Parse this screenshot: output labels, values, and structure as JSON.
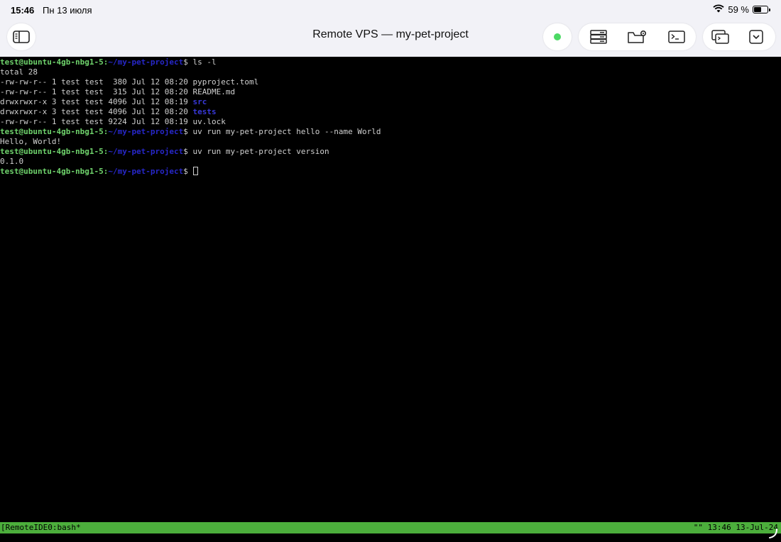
{
  "status": {
    "time": "15:46",
    "date": "Пн 13 июля",
    "battery": "59 %",
    "battery_level": 0.59
  },
  "toolbar": {
    "title": "Remote VPS — my-pet-project",
    "icons": [
      "sidebar-icon",
      "connection-status-dot",
      "server-icon",
      "folder-settings-icon",
      "terminal-icon",
      "windows-icon",
      "chevron-down-icon"
    ]
  },
  "terminal": {
    "prompt_user": "test@ubuntu-4gb-nbg1-5",
    "prompt_path": "~/my-pet-project",
    "cmd1": "ls -l",
    "total": "total 28",
    "files": [
      {
        "meta": "-rw-rw-r-- 1 test test  380 Jul 12 08:20",
        "name": "pyproject.toml",
        "dir": false
      },
      {
        "meta": "-rw-rw-r-- 1 test test  315 Jul 12 08:20",
        "name": "README.md",
        "dir": false
      },
      {
        "meta": "drwxrwxr-x 3 test test 4096 Jul 12 08:19",
        "name": "src",
        "dir": true
      },
      {
        "meta": "drwxrwxr-x 3 test test 4096 Jul 12 08:20",
        "name": "tests",
        "dir": true
      },
      {
        "meta": "-rw-rw-r-- 1 test test 9224 Jul 12 08:19",
        "name": "uv.lock",
        "dir": false
      }
    ],
    "cmd2": "uv run my-pet-project hello --name World",
    "out2": "Hello, World!",
    "cmd3": "uv run my-pet-project version",
    "out3": "0.1.0"
  },
  "tmux": {
    "left": "[RemoteIDE0:bash*",
    "right": "\"\" 13:46 13-Jul-24"
  },
  "colors": {
    "prompt_user": "#6fd36c",
    "prompt_path": "#2727c9",
    "tmux_bar": "#4cae3c",
    "status_dot": "#4cd964"
  }
}
